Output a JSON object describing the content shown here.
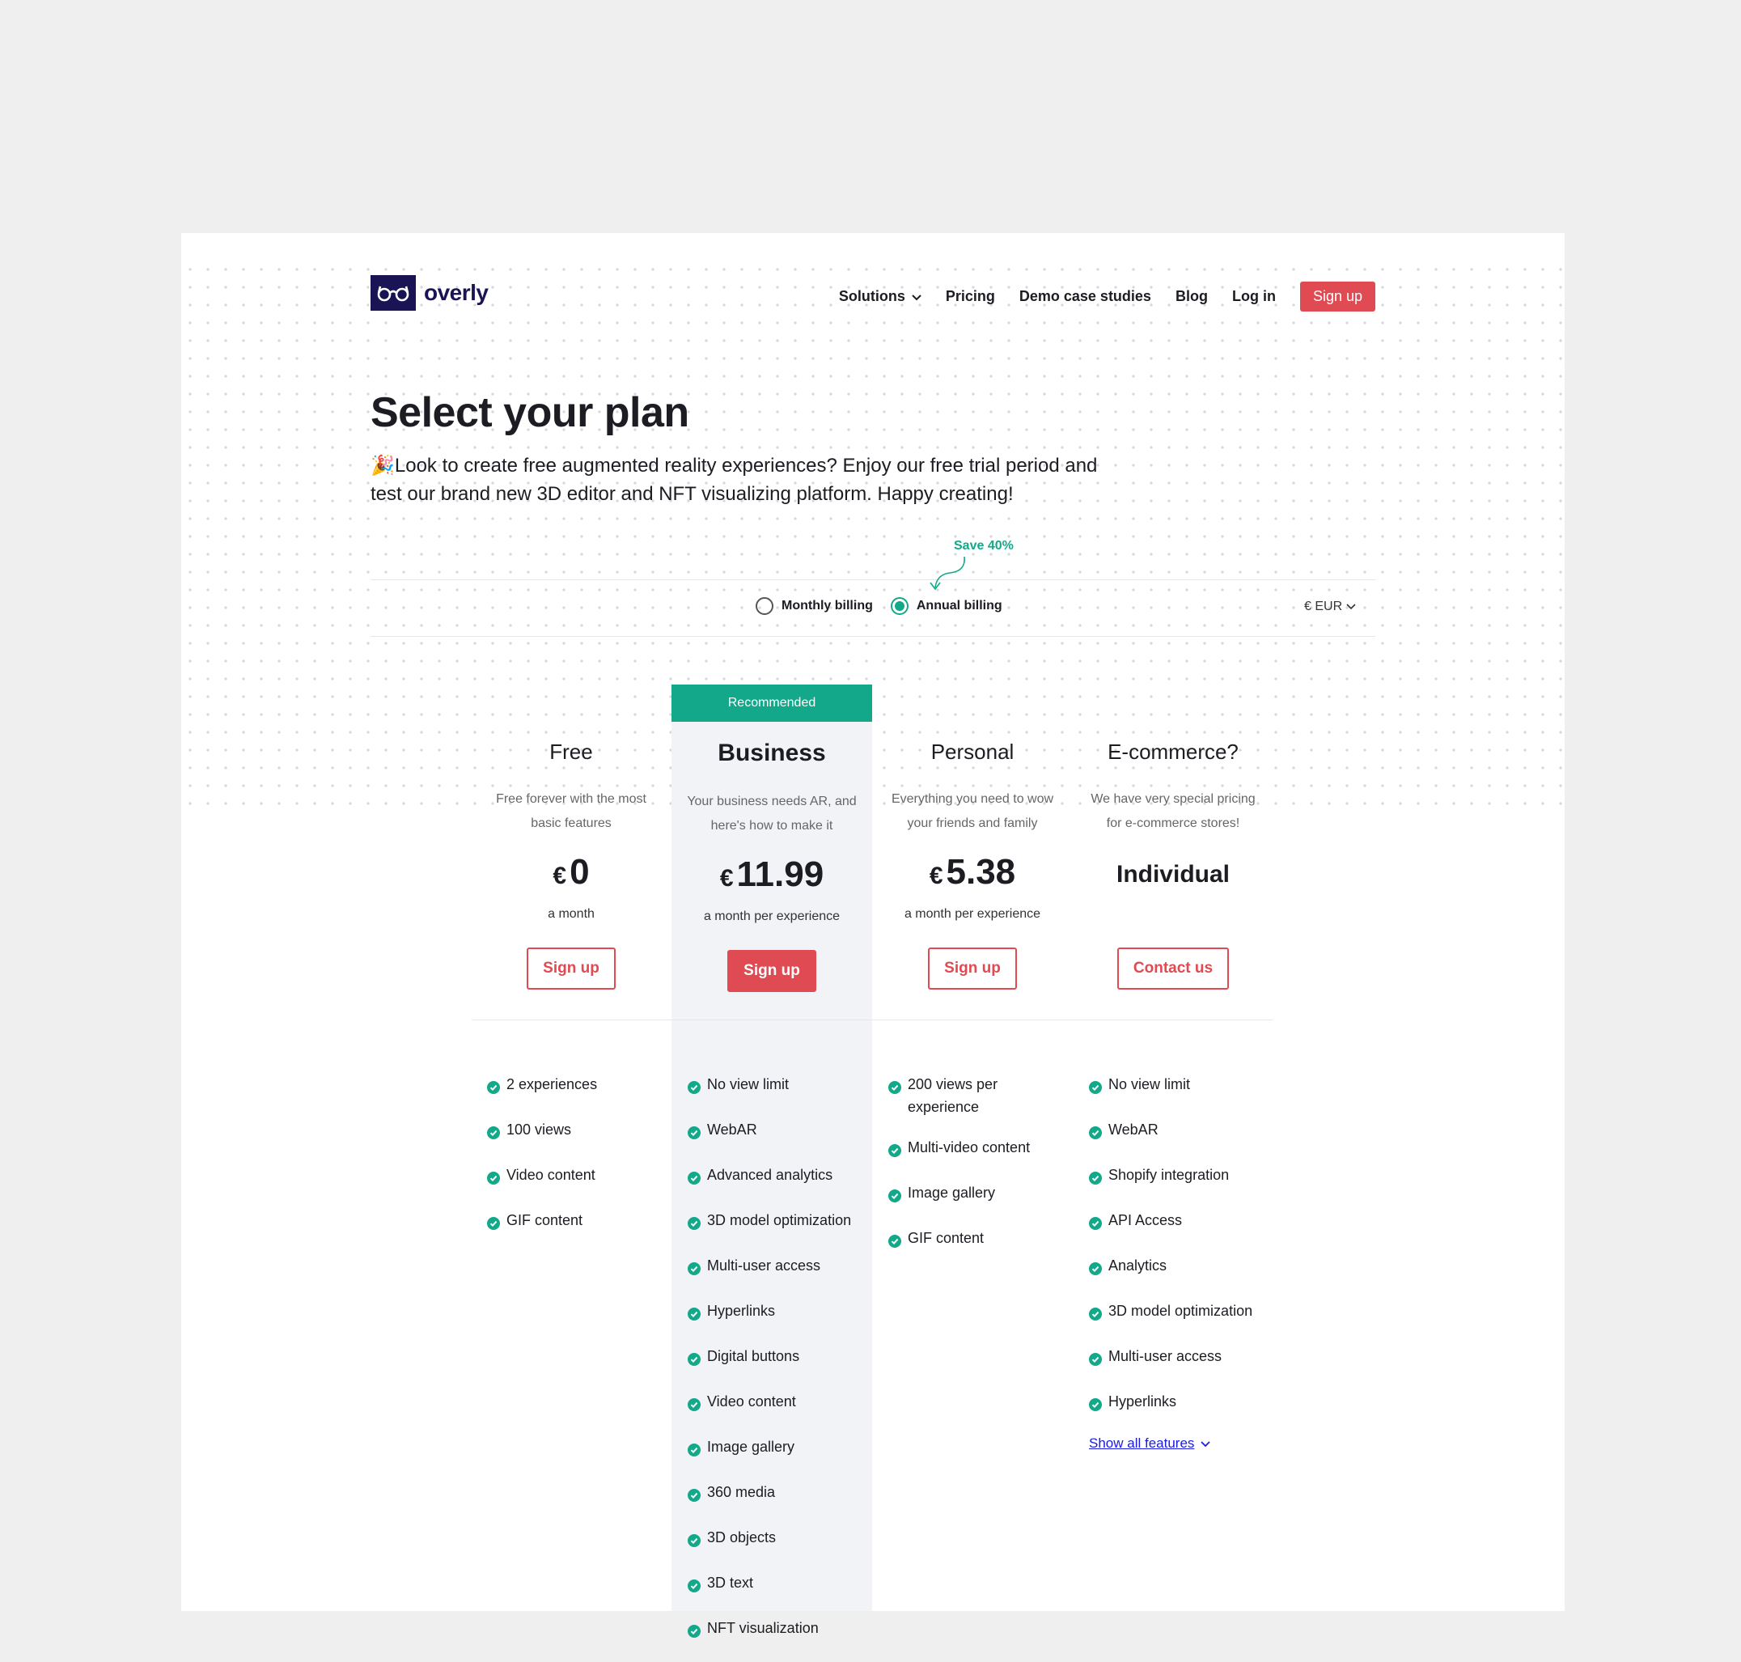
{
  "brand": {
    "name": "overly"
  },
  "nav": {
    "items": [
      "Solutions",
      "Pricing",
      "Demo case studies",
      "Blog",
      "Log in"
    ],
    "signup": "Sign up"
  },
  "hero": {
    "title": "Select your plan",
    "subtitle": "🎉Look to create free augmented reality experiences? Enjoy our free trial period and test our brand new 3D editor and NFT visualizing platform. Happy creating!"
  },
  "billing": {
    "save": "Save 40%",
    "monthly": "Monthly billing",
    "annual": "Annual billing",
    "selected": "annual",
    "currency": "€ EUR"
  },
  "plans": [
    {
      "name": "Free",
      "desc": "Free forever with the most basic features",
      "currency": "€",
      "price": "0",
      "per": "a month",
      "cta": "Sign up",
      "features": [
        "2 experiences",
        "100 views",
        "Video content",
        "GIF content"
      ]
    },
    {
      "badge": "Recommended",
      "name": "Business",
      "desc": "Your business needs AR, and here's how to make it",
      "currency": "€",
      "price": "11.99",
      "per": "a month per experience",
      "cta": "Sign up",
      "features": [
        "No view limit",
        "WebAR",
        "Advanced analytics",
        "3D model optimization",
        "Multi-user access",
        "Hyperlinks",
        "Digital buttons",
        "Video content",
        "Image gallery",
        "360 media",
        "3D objects",
        "3D text",
        "NFT visualization"
      ]
    },
    {
      "name": "Personal",
      "desc": "Everything you need to wow your friends and family",
      "currency": "€",
      "price": "5.38",
      "per": "a month per experience",
      "cta": "Sign up",
      "features": [
        "200 views per experience",
        "Multi-video content",
        "Image gallery",
        "GIF content"
      ]
    },
    {
      "name": "E-commerce?",
      "desc": "We have very special pricing for e-commerce stores!",
      "price_text": "Individual",
      "cta": "Contact us",
      "features": [
        "No view limit",
        "WebAR",
        "Shopify integration",
        "API Access",
        "Analytics",
        "3D model optimization",
        "Multi-user access",
        "Hyperlinks"
      ],
      "show_all": "Show all features"
    }
  ],
  "colors": {
    "brand": "#1b1454",
    "accent": "#e04a52",
    "green": "#13a88a",
    "link": "#1b1be0"
  }
}
